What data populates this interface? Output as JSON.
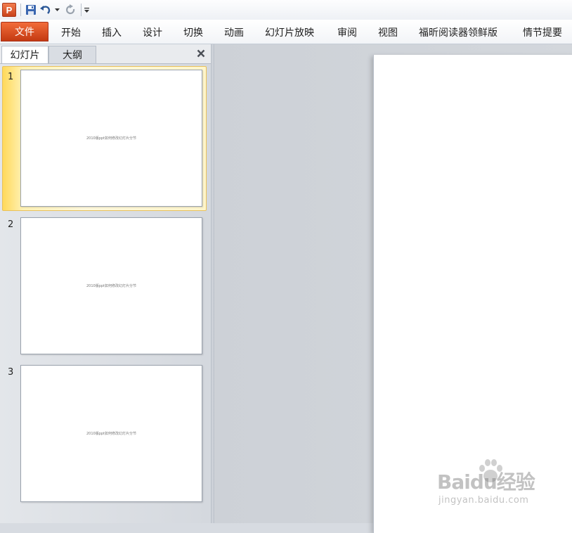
{
  "app": {
    "logo_letter": "P"
  },
  "ribbon": {
    "file_tab": "文件",
    "tabs": [
      "开始",
      "插入",
      "设计",
      "切换",
      "动画",
      "幻灯片放映",
      "审阅",
      "视图",
      "福昕阅读器领鲜版",
      "情节提要"
    ]
  },
  "slides_pane": {
    "tab_slides": "幻灯片",
    "tab_outline": "大纲",
    "slides": [
      {
        "number": "1",
        "text": "2010版ppt如何修改幻灯片分节",
        "selected": true
      },
      {
        "number": "2",
        "text": "2010版ppt如何修改幻灯片分节",
        "selected": false
      },
      {
        "number": "3",
        "text": "2010版ppt如何修改幻灯片分节",
        "selected": false
      }
    ]
  },
  "watermark": {
    "main": "Baidu经验",
    "sub": "jingyan.baidu.com"
  },
  "colors": {
    "file_tab": "#d9481c",
    "selection": "#ffe27a",
    "accent_blue": "#2b5797"
  }
}
